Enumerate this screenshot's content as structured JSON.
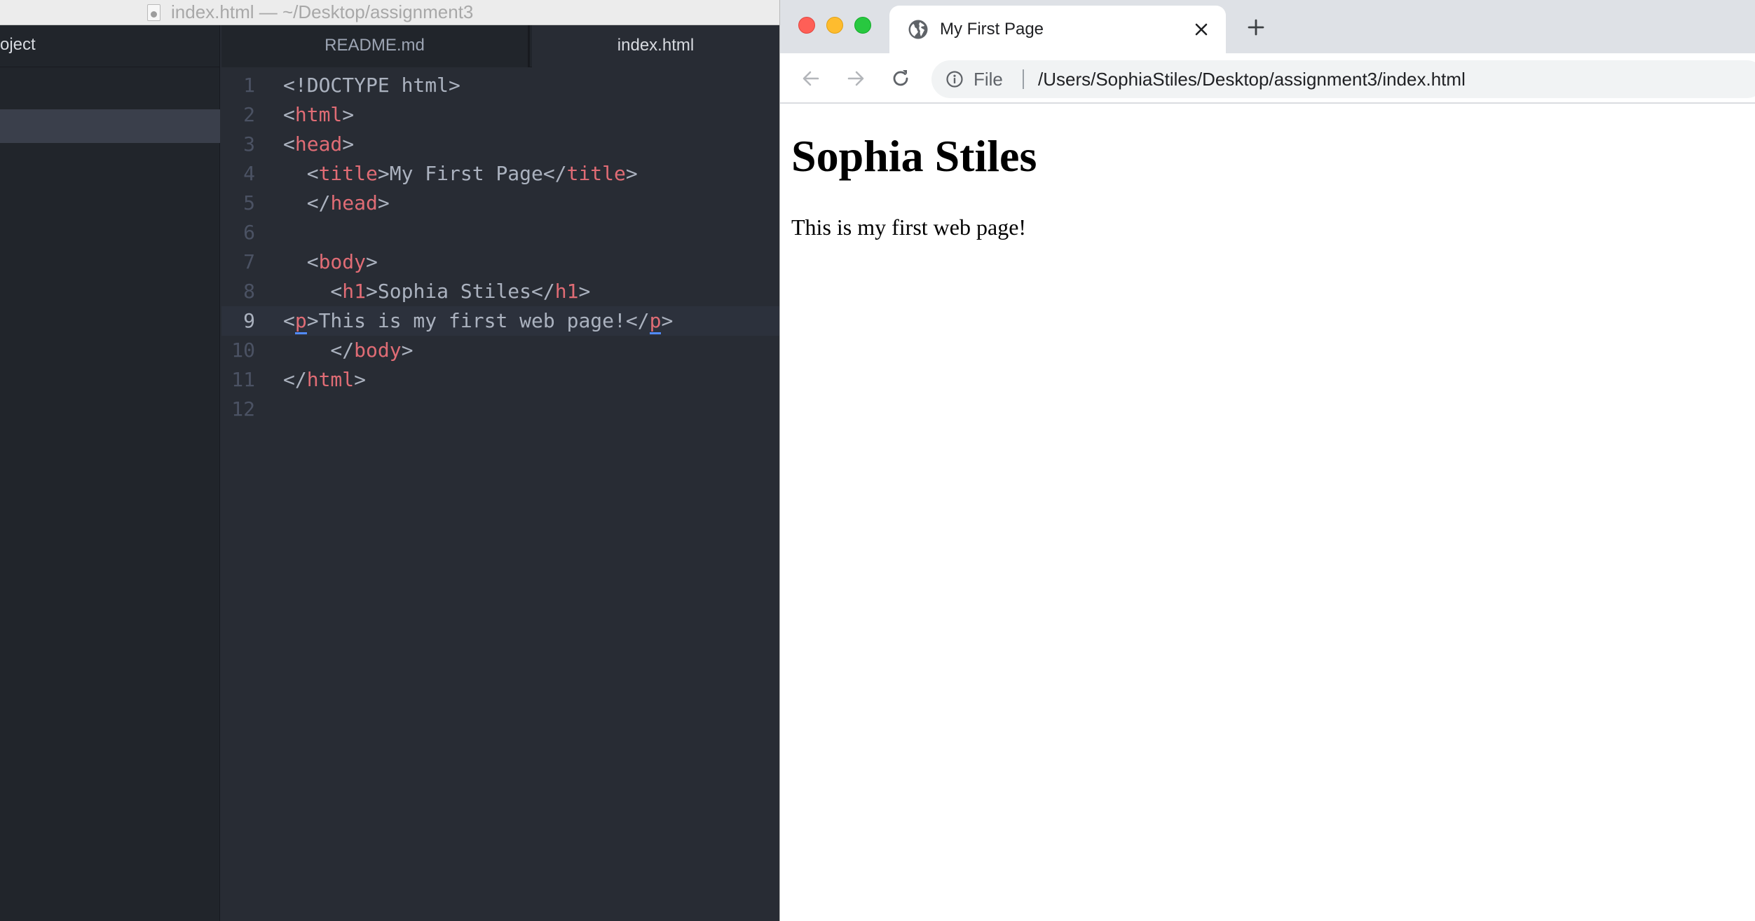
{
  "editor": {
    "window_title": "index.html — ~/Desktop/assignment3",
    "tree_header": "oject",
    "tabs": [
      {
        "label": "README.md",
        "active": false
      },
      {
        "label": "index.html",
        "active": true
      }
    ],
    "current_line": 9,
    "lines": [
      {
        "num": "1",
        "text": "<!DOCTYPE html>"
      },
      {
        "num": "2",
        "text": "<html>"
      },
      {
        "num": "3",
        "text": "<head>"
      },
      {
        "num": "4",
        "text": "  <title>My First Page</title>"
      },
      {
        "num": "5",
        "text": "  </head>"
      },
      {
        "num": "6",
        "text": ""
      },
      {
        "num": "7",
        "text": "  <body>"
      },
      {
        "num": "8",
        "text": "    <h1>Sophia Stiles</h1>"
      },
      {
        "num": "9",
        "text": "<p>This is my first web page!</p>"
      },
      {
        "num": "10",
        "text": "    </body>"
      },
      {
        "num": "11",
        "text": "</html>"
      },
      {
        "num": "12",
        "text": ""
      }
    ],
    "colors": {
      "background": "#282c34",
      "tag": "#e06c75",
      "text": "#abb2bf",
      "gutter": "#4b5263"
    }
  },
  "browser": {
    "tab_title": "My First Page",
    "address": {
      "scheme_label": "File",
      "url": "/Users/SophiaStiles/Desktop/assignment3/index.html"
    },
    "page": {
      "heading": "Sophia Stiles",
      "paragraph": "This is my first web page!"
    },
    "icons": [
      "globe-icon",
      "close-icon",
      "plus-icon",
      "back-arrow-icon",
      "forward-arrow-icon",
      "reload-icon",
      "info-icon"
    ]
  }
}
